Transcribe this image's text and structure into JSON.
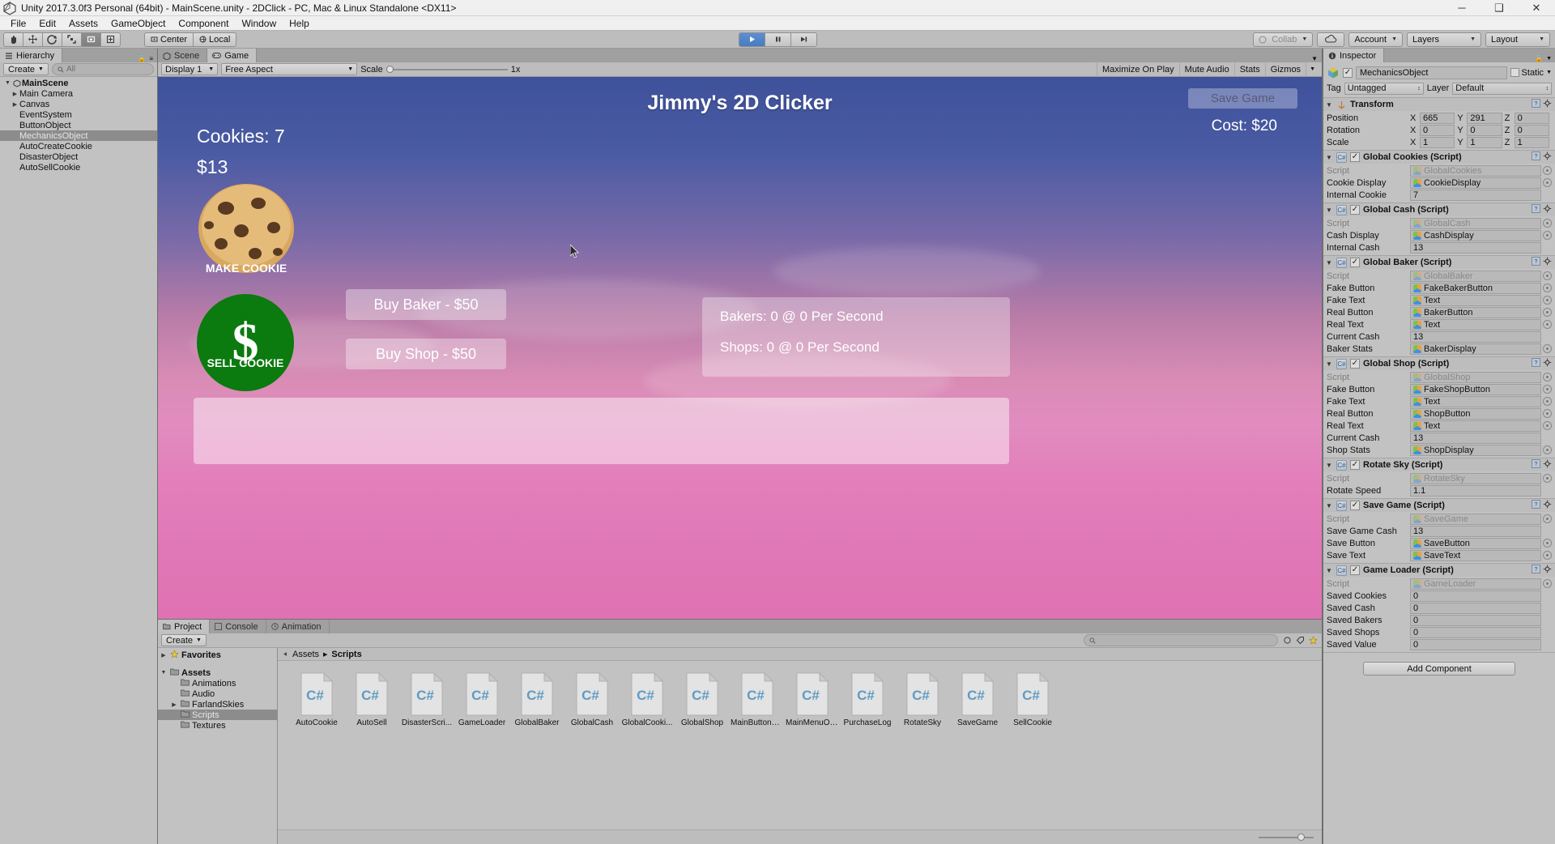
{
  "window": {
    "title": "Unity 2017.3.0f3 Personal (64bit) - MainScene.unity - 2DClick - PC, Mac & Linux Standalone <DX11>",
    "minimize": "─",
    "maximize": "❑",
    "close": "✕"
  },
  "menu": [
    "File",
    "Edit",
    "Assets",
    "GameObject",
    "Component",
    "Window",
    "Help"
  ],
  "toolbar": {
    "tools": [
      "hand-tool",
      "move-tool",
      "rotate-tool",
      "scale-tool",
      "rect-tool",
      "transform-tool"
    ],
    "pivot": "Center",
    "space": "Local",
    "play": "▶",
    "pause": "❚❚",
    "step": "▶❘",
    "collab": "Collab",
    "account": "Account",
    "layers": "Layers",
    "layout": "Layout"
  },
  "hierarchy": {
    "tab": "Hierarchy",
    "create": "Create",
    "search_placeholder": "All",
    "items": [
      {
        "label": "MainScene",
        "depth": 0,
        "expandable": true,
        "selected": false,
        "root": true
      },
      {
        "label": "Main Camera",
        "depth": 1,
        "expandable": true,
        "selected": false,
        "root": false
      },
      {
        "label": "Canvas",
        "depth": 1,
        "expandable": true,
        "selected": false,
        "root": false
      },
      {
        "label": "EventSystem",
        "depth": 1,
        "expandable": false,
        "selected": false,
        "root": false
      },
      {
        "label": "ButtonObject",
        "depth": 1,
        "expandable": false,
        "selected": false,
        "root": false
      },
      {
        "label": "MechanicsObject",
        "depth": 1,
        "expandable": false,
        "selected": true,
        "root": false
      },
      {
        "label": "AutoCreateCookie",
        "depth": 1,
        "expandable": false,
        "selected": false,
        "root": false
      },
      {
        "label": "DisasterObject",
        "depth": 1,
        "expandable": false,
        "selected": false,
        "root": false
      },
      {
        "label": "AutoSellCookie",
        "depth": 1,
        "expandable": false,
        "selected": false,
        "root": false
      }
    ]
  },
  "view_tabs": {
    "scene": "Scene",
    "game": "Game"
  },
  "game_toolbar": {
    "display": "Display 1",
    "aspect": "Free Aspect",
    "scale_label": "Scale",
    "scale_value": "1x",
    "maximize_on_play": "Maximize On Play",
    "mute_audio": "Mute Audio",
    "stats": "Stats",
    "gizmos": "Gizmos"
  },
  "game": {
    "title": "Jimmy's 2D Clicker",
    "cookies": "Cookies: 7",
    "cash": "$13",
    "save_button": "Save Game",
    "cost": "Cost: $20",
    "make_cookie": "MAKE COOKIE",
    "sell_cookie": "SELL COOKIE",
    "sell_symbol": "$",
    "buy_baker": "Buy Baker - $50",
    "buy_shop": "Buy Shop - $50",
    "bakers_stat": "Bakers: 0 @ 0 Per Second",
    "shops_stat": "Shops: 0 @ 0 Per Second"
  },
  "project": {
    "tabs": [
      "Project",
      "Console",
      "Animation"
    ],
    "active_tab": "Project",
    "create": "Create",
    "breadcrumb": [
      "Assets",
      "Scripts"
    ],
    "tree": [
      {
        "label": "Favorites",
        "depth": 0,
        "expandable": true,
        "selected": false,
        "icon": "star"
      },
      {
        "label": "Assets",
        "depth": 0,
        "expandable": true,
        "selected": false,
        "icon": "folder"
      },
      {
        "label": "Animations",
        "depth": 1,
        "expandable": false,
        "selected": false,
        "icon": "folder"
      },
      {
        "label": "Audio",
        "depth": 1,
        "expandable": false,
        "selected": false,
        "icon": "folder"
      },
      {
        "label": "FarlandSkies",
        "depth": 1,
        "expandable": true,
        "selected": false,
        "icon": "folder"
      },
      {
        "label": "Scripts",
        "depth": 1,
        "expandable": false,
        "selected": true,
        "icon": "folder"
      },
      {
        "label": "Textures",
        "depth": 1,
        "expandable": false,
        "selected": false,
        "icon": "folder"
      }
    ],
    "assets": [
      "AutoCookie",
      "AutoSell",
      "DisasterScri...",
      "GameLoader",
      "GlobalBaker",
      "GlobalCash",
      "GlobalCooki...",
      "GlobalShop",
      "MainButtonCl...",
      "MainMenuOp...",
      "PurchaseLog",
      "RotateSky",
      "SaveGame",
      "SellCookie"
    ]
  },
  "inspector": {
    "tab": "Inspector",
    "object_name": "MechanicsObject",
    "enabled": true,
    "static_label": "Static",
    "tag_label": "Tag",
    "tag_value": "Untagged",
    "layer_label": "Layer",
    "layer_value": "Default",
    "transform": {
      "title": "Transform",
      "position_label": "Position",
      "rotation_label": "Rotation",
      "scale_label": "Scale",
      "position": {
        "x": "665",
        "y": "291",
        "z": "0"
      },
      "rotation": {
        "x": "0",
        "y": "0",
        "z": "0"
      },
      "scale": {
        "x": "1",
        "y": "1",
        "z": "1"
      }
    },
    "components": [
      {
        "title": "Global Cookies (Script)",
        "enabled": true,
        "rows": [
          {
            "label": "Script",
            "value": "GlobalCookies",
            "type": "object",
            "dim": true
          },
          {
            "label": "Cookie Display",
            "value": "CookieDisplay",
            "type": "object",
            "dim": false
          },
          {
            "label": "Internal Cookie",
            "value": "7",
            "type": "text",
            "dim": false
          }
        ]
      },
      {
        "title": "Global Cash (Script)",
        "enabled": true,
        "rows": [
          {
            "label": "Script",
            "value": "GlobalCash",
            "type": "object",
            "dim": true
          },
          {
            "label": "Cash Display",
            "value": "CashDisplay",
            "type": "object",
            "dim": false
          },
          {
            "label": "Internal Cash",
            "value": "13",
            "type": "text",
            "dim": false
          }
        ]
      },
      {
        "title": "Global Baker (Script)",
        "enabled": true,
        "rows": [
          {
            "label": "Script",
            "value": "GlobalBaker",
            "type": "object",
            "dim": true
          },
          {
            "label": "Fake Button",
            "value": "FakeBakerButton",
            "type": "object",
            "dim": false
          },
          {
            "label": "Fake Text",
            "value": "Text",
            "type": "object",
            "dim": false
          },
          {
            "label": "Real Button",
            "value": "BakerButton",
            "type": "object",
            "dim": false
          },
          {
            "label": "Real Text",
            "value": "Text",
            "type": "object",
            "dim": false
          },
          {
            "label": "Current Cash",
            "value": "13",
            "type": "text",
            "dim": false
          },
          {
            "label": "Baker Stats",
            "value": "BakerDisplay",
            "type": "object",
            "dim": false
          }
        ]
      },
      {
        "title": "Global Shop (Script)",
        "enabled": true,
        "rows": [
          {
            "label": "Script",
            "value": "GlobalShop",
            "type": "object",
            "dim": true
          },
          {
            "label": "Fake Button",
            "value": "FakeShopButton",
            "type": "object",
            "dim": false
          },
          {
            "label": "Fake Text",
            "value": "Text",
            "type": "object",
            "dim": false
          },
          {
            "label": "Real Button",
            "value": "ShopButton",
            "type": "object",
            "dim": false
          },
          {
            "label": "Real Text",
            "value": "Text",
            "type": "object",
            "dim": false
          },
          {
            "label": "Current Cash",
            "value": "13",
            "type": "text",
            "dim": false
          },
          {
            "label": "Shop Stats",
            "value": "ShopDisplay",
            "type": "object",
            "dim": false
          }
        ]
      },
      {
        "title": "Rotate Sky (Script)",
        "enabled": true,
        "rows": [
          {
            "label": "Script",
            "value": "RotateSky",
            "type": "object",
            "dim": true
          },
          {
            "label": "Rotate Speed",
            "value": "1.1",
            "type": "text",
            "dim": false
          }
        ]
      },
      {
        "title": "Save Game (Script)",
        "enabled": true,
        "rows": [
          {
            "label": "Script",
            "value": "SaveGame",
            "type": "object",
            "dim": true
          },
          {
            "label": "Save Game Cash",
            "value": "13",
            "type": "text",
            "dim": false
          },
          {
            "label": "Save Button",
            "value": "SaveButton",
            "type": "object",
            "dim": false
          },
          {
            "label": "Save Text",
            "value": "SaveText",
            "type": "object",
            "dim": false
          }
        ]
      },
      {
        "title": "Game Loader (Script)",
        "enabled": true,
        "rows": [
          {
            "label": "Script",
            "value": "GameLoader",
            "type": "object",
            "dim": true
          },
          {
            "label": "Saved Cookies",
            "value": "0",
            "type": "text",
            "dim": false
          },
          {
            "label": "Saved Cash",
            "value": "0",
            "type": "text",
            "dim": false
          },
          {
            "label": "Saved Bakers",
            "value": "0",
            "type": "text",
            "dim": false
          },
          {
            "label": "Saved Shops",
            "value": "0",
            "type": "text",
            "dim": false
          },
          {
            "label": "Saved Value",
            "value": "0",
            "type": "text",
            "dim": false
          }
        ]
      }
    ],
    "add_component": "Add Component"
  }
}
